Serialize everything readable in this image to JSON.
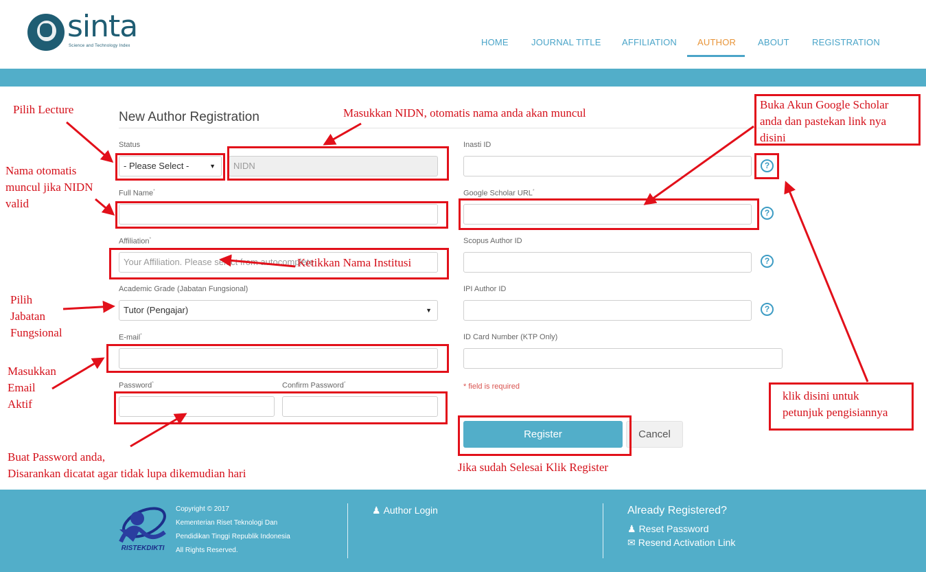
{
  "header": {
    "logo_text": "sinta",
    "logo_subtitle": "Science and Technology Index",
    "nav": [
      "HOME",
      "JOURNAL TITLE",
      "AFFILIATION",
      "AUTHOR",
      "ABOUT",
      "REGISTRATION"
    ],
    "active_nav": "AUTHOR"
  },
  "form": {
    "title": "New Author Registration",
    "status_label": "Status",
    "status_value": "- Please Select -",
    "nidn_placeholder": "NIDN",
    "fullname_label": "Full Name",
    "affiliation_label": "Affiliation",
    "affiliation_placeholder": "Your Affiliation. Please select from autocomplete",
    "grade_label": "Academic Grade (Jabatan Fungsional)",
    "grade_value": "Tutor (Pengajar)",
    "email_label": "E-mail",
    "password_label": "Password",
    "confirm_label": "Confirm Password",
    "inasti_label": "Inasti ID",
    "scholar_label": "Google Scholar URL",
    "scopus_label": "Scopus Author ID",
    "ipi_label": "IPI Author ID",
    "idcard_label": "ID Card Number (KTP Only)",
    "required_note": "* field is required",
    "register_label": "Register",
    "cancel_label": "Cancel",
    "help_glyph": "?"
  },
  "annotations": {
    "pilih_lecture": "Pilih Lecture",
    "nidn_note": "Masukkan NIDN, otomatis nama anda akan muncul",
    "nama_otomatis": [
      "Nama otomatis",
      "muncul jika NIDN",
      "valid"
    ],
    "institusi": "Ketikkan Nama Institusi",
    "jabatan": [
      "Pilih",
      "Jabatan",
      "Fungsional"
    ],
    "email_aktif": [
      "Masukkan",
      "Email",
      "Aktif"
    ],
    "password_note": [
      "Buat Password anda,",
      "Disarankan dicatat agar tidak lupa dikemudian hari"
    ],
    "scholar_note": [
      "Buka Akun Google Scholar",
      "anda dan pastekan link nya",
      "disini"
    ],
    "help_note": [
      "klik disini untuk",
      "petunjuk pengisiannya"
    ],
    "register_note": "Jika sudah Selesai Klik Register"
  },
  "footer": {
    "copyright": [
      "Copyright © 2017",
      "Kementerian Riset Teknologi Dan",
      "Pendidikan Tinggi Republik Indonesia",
      "All Rights Reserved."
    ],
    "ristek_logo_text": "RISTEKDIKTI",
    "author_login": "Author Login",
    "already_registered": "Already Registered?",
    "reset_password": "Reset Password",
    "resend_activation": "Resend Activation Link"
  },
  "colors": {
    "accent": "#52aec9",
    "nav": "#4aa4c8",
    "active": "#e8953a",
    "annotation": "#e2101a",
    "logo": "#1f5d73"
  }
}
